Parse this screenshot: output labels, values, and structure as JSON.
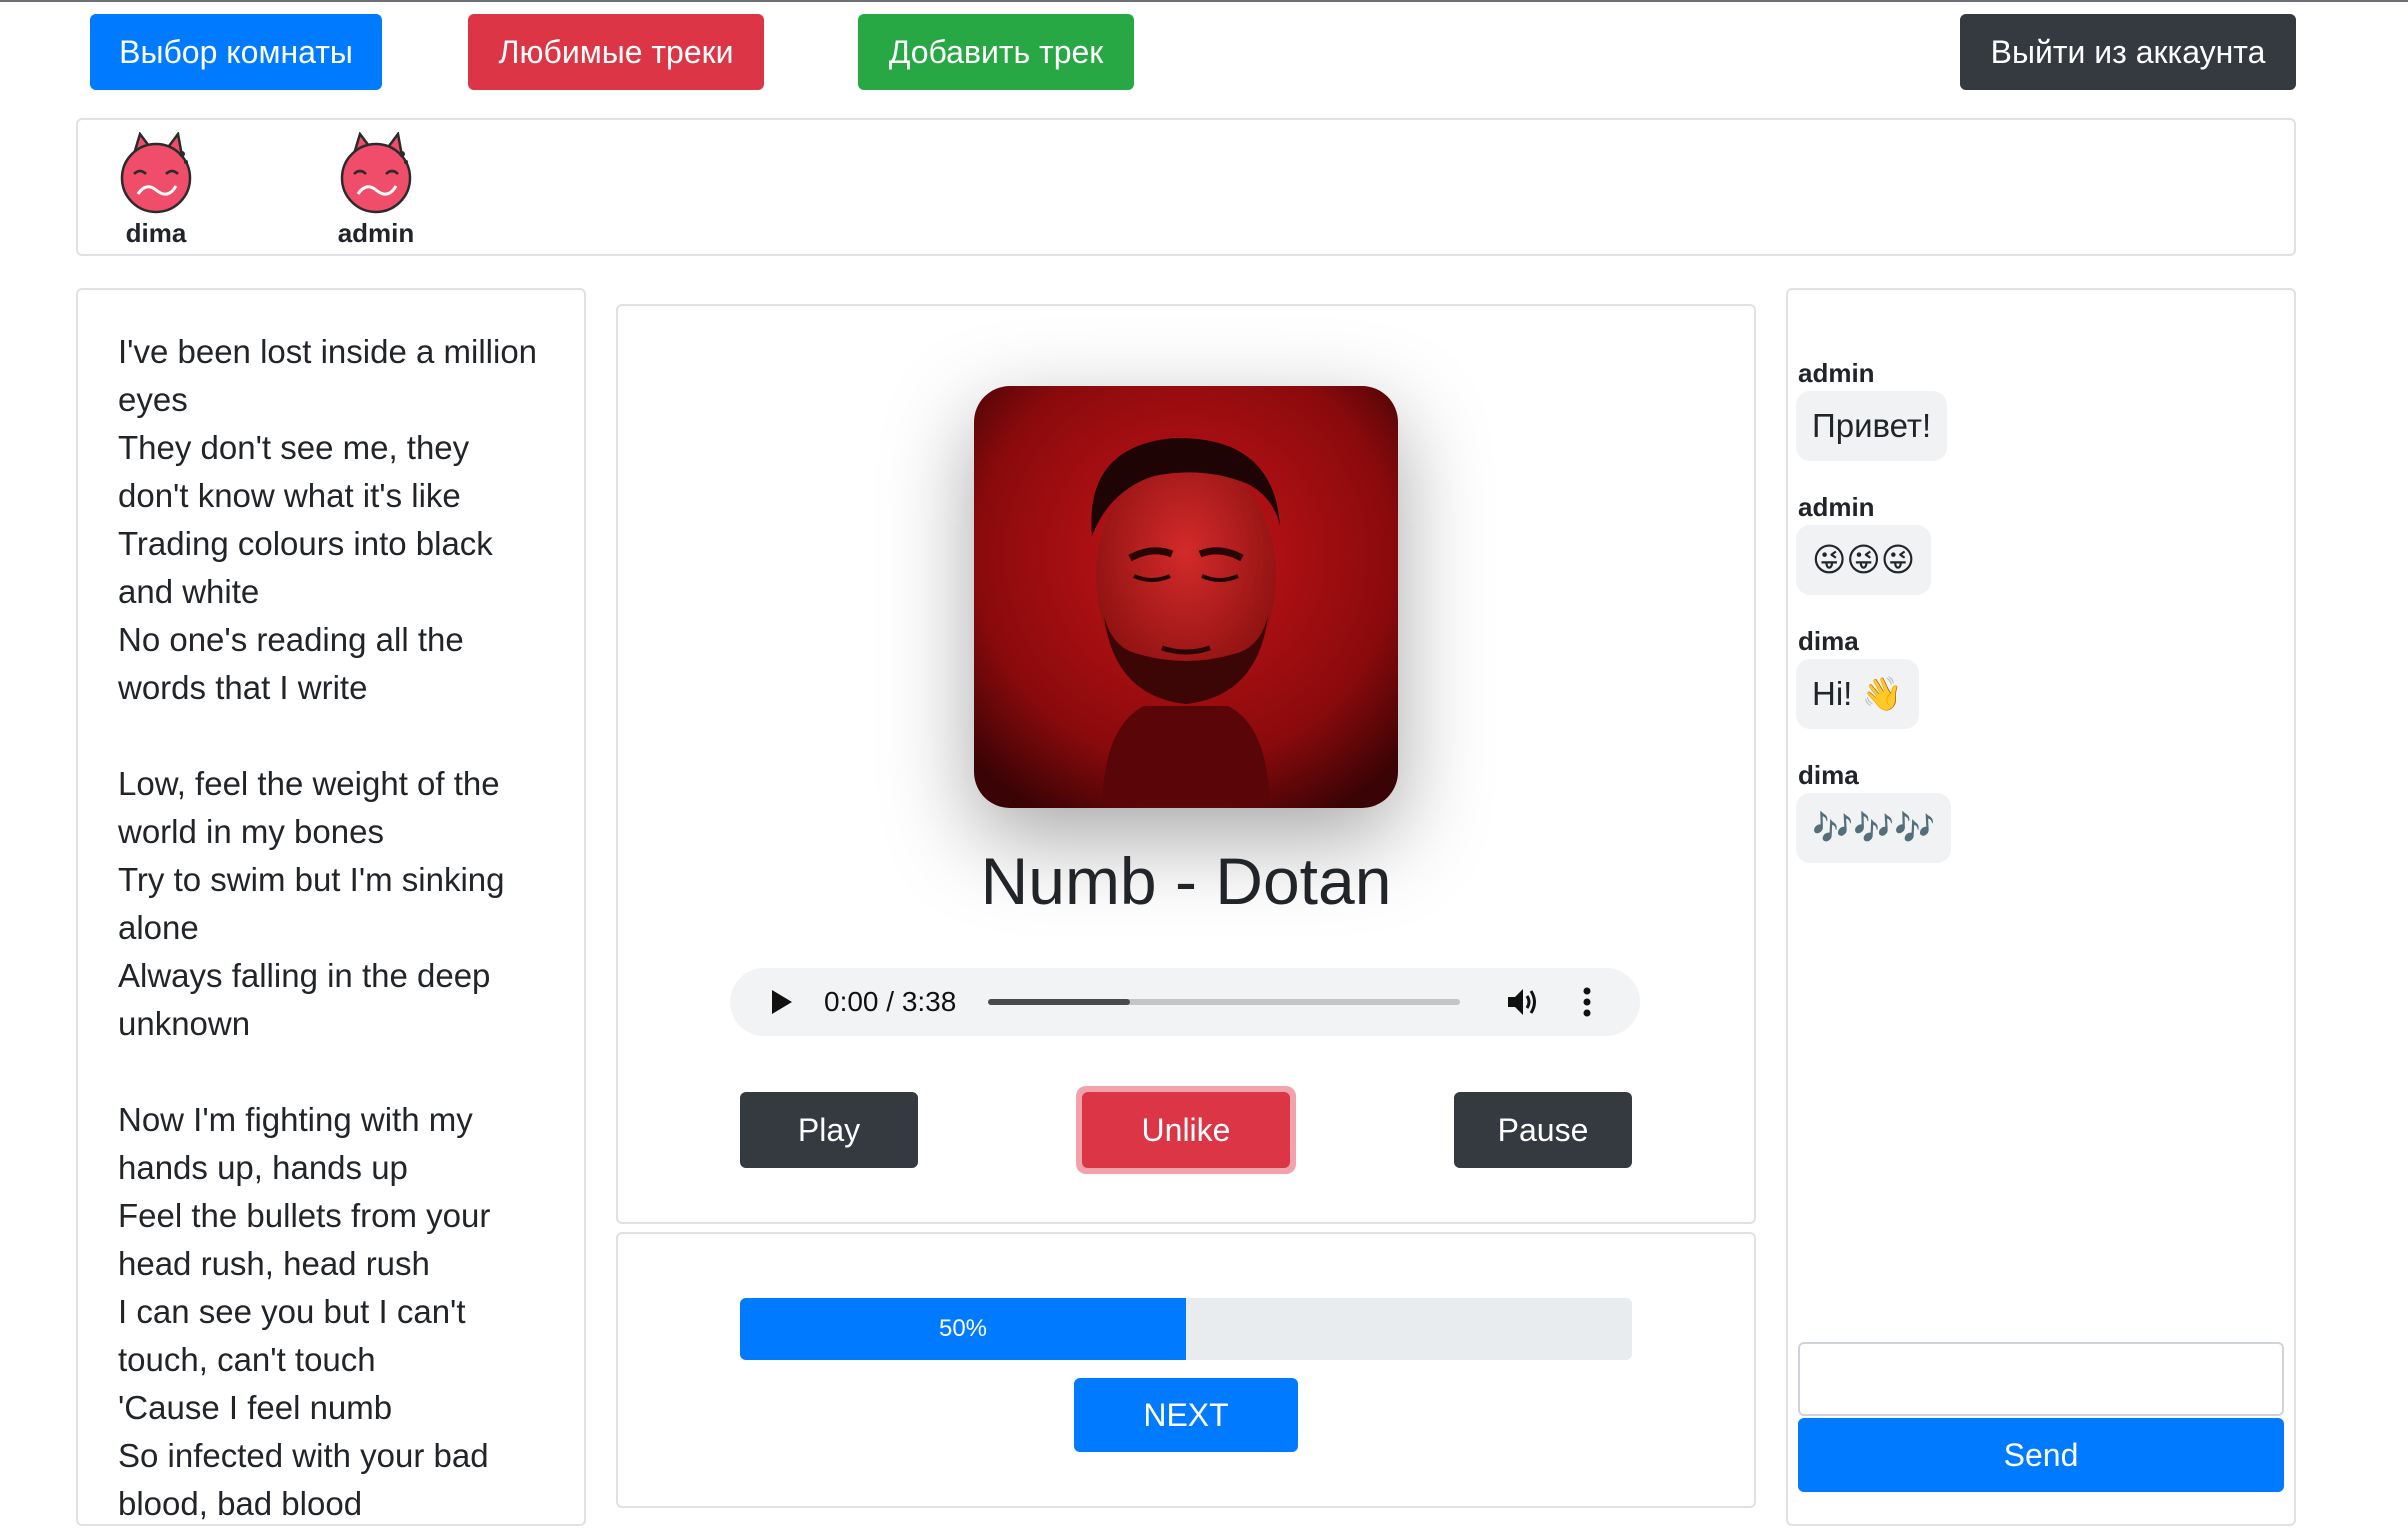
{
  "nav": {
    "rooms_label": "Выбор комнаты",
    "favorites_label": "Любимые треки",
    "add_label": "Добавить трек",
    "logout_label": "Выйти из аккаунта"
  },
  "users": [
    {
      "name": "dima"
    },
    {
      "name": "admin"
    }
  ],
  "lyrics": {
    "lines": [
      "I've been lost inside a million",
      "eyes",
      "They don't see me, they",
      "don't know what it's like",
      "Trading colours into black",
      "and white",
      "No one's reading all the",
      "words that I write",
      "",
      "Low, feel the weight of the",
      "world in my bones",
      "Try to swim but I'm sinking",
      "alone",
      "Always falling in the deep",
      "unknown",
      "",
      "Now I'm fighting with my",
      "hands up, hands up",
      "Feel the bullets from your",
      "head rush, head rush",
      "I can see you but I can't",
      "touch, can't touch",
      "'Cause I feel numb",
      "So infected with your bad",
      "blood, bad blood"
    ]
  },
  "player": {
    "title": "Numb - Dotan",
    "time": "0:00 / 3:38",
    "seek_fraction": 0.3,
    "play_label": "Play",
    "unlike_label": "Unlike",
    "pause_label": "Pause"
  },
  "vote": {
    "progress_percent": 50,
    "progress_label": "50%",
    "next_label": "NEXT"
  },
  "chat": {
    "messages": [
      {
        "author": "admin",
        "text": "Привет!"
      },
      {
        "author": "admin",
        "text": "😜😜😜"
      },
      {
        "author": "dima",
        "text": "Hi! 👋"
      },
      {
        "author": "dima",
        "text": "🎶🎶🎶"
      }
    ],
    "input_value": "",
    "send_label": "Send"
  },
  "colors": {
    "primary": "#007bff",
    "danger": "#dc3545",
    "success": "#28a745",
    "dark": "#343a40"
  }
}
